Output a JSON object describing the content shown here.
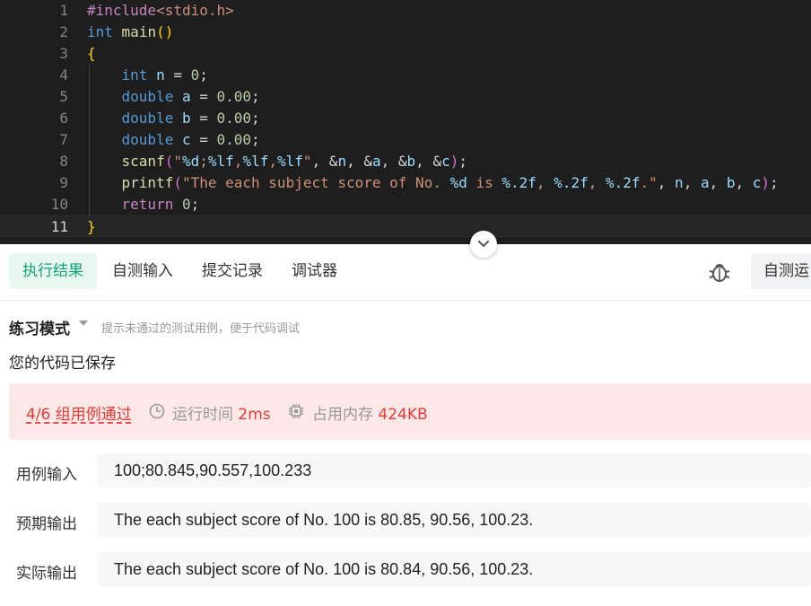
{
  "editor": {
    "line_numbers": [
      "1",
      "2",
      "3",
      "4",
      "5",
      "6",
      "7",
      "8",
      "9",
      "10",
      "11"
    ],
    "lines": [
      {
        "num": "1",
        "tokens": [
          {
            "t": "#include",
            "c": "pp"
          },
          {
            "t": "<stdio.h>",
            "c": "hdr"
          }
        ]
      },
      {
        "num": "2",
        "tokens": [
          {
            "t": "int",
            "c": "kw"
          },
          {
            "t": " "
          },
          {
            "t": "main",
            "c": "fn"
          },
          {
            "t": "()",
            "c": "br1"
          }
        ]
      },
      {
        "num": "3",
        "tokens": [
          {
            "t": "{",
            "c": "br1"
          }
        ]
      },
      {
        "num": "4",
        "tokens": [
          {
            "t": "    "
          },
          {
            "t": "int",
            "c": "kw"
          },
          {
            "t": " "
          },
          {
            "t": "n",
            "c": "var"
          },
          {
            "t": " = "
          },
          {
            "t": "0",
            "c": "num"
          },
          {
            "t": ";"
          }
        ]
      },
      {
        "num": "5",
        "tokens": [
          {
            "t": "    "
          },
          {
            "t": "double",
            "c": "kw"
          },
          {
            "t": " "
          },
          {
            "t": "a",
            "c": "var"
          },
          {
            "t": " = "
          },
          {
            "t": "0.00",
            "c": "num"
          },
          {
            "t": ";"
          }
        ]
      },
      {
        "num": "6",
        "tokens": [
          {
            "t": "    "
          },
          {
            "t": "double",
            "c": "kw"
          },
          {
            "t": " "
          },
          {
            "t": "b",
            "c": "var"
          },
          {
            "t": " = "
          },
          {
            "t": "0.00",
            "c": "num"
          },
          {
            "t": ";"
          }
        ]
      },
      {
        "num": "7",
        "tokens": [
          {
            "t": "    "
          },
          {
            "t": "double",
            "c": "kw"
          },
          {
            "t": " "
          },
          {
            "t": "c",
            "c": "var"
          },
          {
            "t": " = "
          },
          {
            "t": "0.00",
            "c": "num"
          },
          {
            "t": ";"
          }
        ]
      },
      {
        "num": "8",
        "tokens": [
          {
            "t": "    "
          },
          {
            "t": "scanf",
            "c": "fn"
          },
          {
            "t": "(",
            "c": "br2"
          },
          {
            "t": "\"",
            "c": "str"
          },
          {
            "t": "%d",
            "c": "fmt"
          },
          {
            "t": ";",
            "c": "str"
          },
          {
            "t": "%lf",
            "c": "fmt"
          },
          {
            "t": ",",
            "c": "str"
          },
          {
            "t": "%lf",
            "c": "fmt"
          },
          {
            "t": ",",
            "c": "str"
          },
          {
            "t": "%lf",
            "c": "fmt"
          },
          {
            "t": "\"",
            "c": "str"
          },
          {
            "t": ", &"
          },
          {
            "t": "n",
            "c": "var"
          },
          {
            "t": ", &"
          },
          {
            "t": "a",
            "c": "var"
          },
          {
            "t": ", &"
          },
          {
            "t": "b",
            "c": "var"
          },
          {
            "t": ", &"
          },
          {
            "t": "c",
            "c": "var"
          },
          {
            "t": ")",
            "c": "br2"
          },
          {
            "t": ";"
          }
        ]
      },
      {
        "num": "9",
        "tokens": [
          {
            "t": "    "
          },
          {
            "t": "printf",
            "c": "fn"
          },
          {
            "t": "(",
            "c": "br2"
          },
          {
            "t": "\"The each subject score of No. ",
            "c": "str"
          },
          {
            "t": "%d",
            "c": "fmt"
          },
          {
            "t": " is ",
            "c": "str"
          },
          {
            "t": "%.2f",
            "c": "fmt"
          },
          {
            "t": ", ",
            "c": "str"
          },
          {
            "t": "%.2f",
            "c": "fmt"
          },
          {
            "t": ", ",
            "c": "str"
          },
          {
            "t": "%.2f",
            "c": "fmt"
          },
          {
            "t": ".\"",
            "c": "str"
          },
          {
            "t": ", "
          },
          {
            "t": "n",
            "c": "var"
          },
          {
            "t": ", "
          },
          {
            "t": "a",
            "c": "var"
          },
          {
            "t": ", "
          },
          {
            "t": "b",
            "c": "var"
          },
          {
            "t": ", "
          },
          {
            "t": "c",
            "c": "var"
          },
          {
            "t": ")",
            "c": "br2"
          },
          {
            "t": ";"
          }
        ]
      },
      {
        "num": "10",
        "tokens": [
          {
            "t": "    "
          },
          {
            "t": "return",
            "c": "ctl"
          },
          {
            "t": " "
          },
          {
            "t": "0",
            "c": "num"
          },
          {
            "t": ";"
          }
        ]
      },
      {
        "num": "11",
        "tokens": [
          {
            "t": "}",
            "c": "br1"
          }
        ]
      }
    ],
    "current_line": "11"
  },
  "tabs": {
    "items": [
      {
        "label": "执行结果"
      },
      {
        "label": "自测输入"
      },
      {
        "label": "提交记录"
      },
      {
        "label": "调试器"
      }
    ],
    "active_index": 0,
    "self_test_label": "自测运"
  },
  "result": {
    "mode_label": "练习模式",
    "mode_hint": "提示未通过的测试用例，便于代码调试",
    "saved_text": "您的代码已保存",
    "pass_count": "4/6 组用例通过",
    "runtime_label": "运行时间",
    "runtime_value": "2ms",
    "memory_label": "占用内存",
    "memory_value": "424KB",
    "input_label": "用例输入",
    "input_value": "100;80.845,90.557,100.233",
    "expected_label": "预期输出",
    "expected_value": "The each subject score of No. 100 is 80.85, 90.56, 100.23.",
    "actual_label": "实际输出",
    "actual_value": "The each subject score of No. 100 is 80.84, 90.56, 100.23."
  },
  "colors": {
    "accent": "#16a37b",
    "error": "#e53935",
    "editor_bg": "#1e1e1e",
    "banner_bg": "#fde8e8"
  }
}
